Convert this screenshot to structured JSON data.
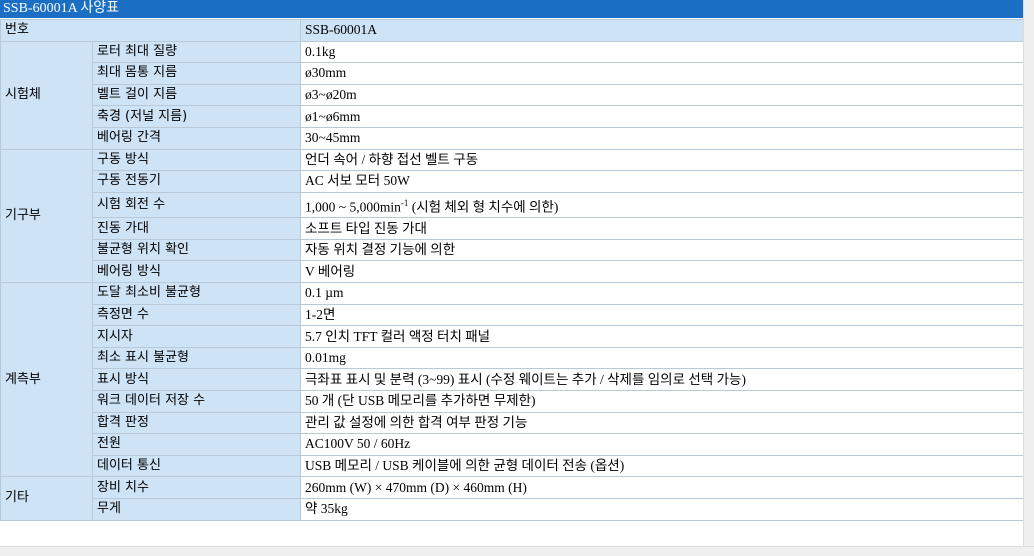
{
  "title": "SSB-60001A 사양표",
  "header": {
    "label": "번호",
    "value": "SSB-60001A"
  },
  "groups": [
    {
      "category": "시험체",
      "rows": [
        {
          "label": "로터 최대 질량",
          "value": "0.1kg"
        },
        {
          "label": "최대 몸통 지름",
          "value": "ø30mm"
        },
        {
          "label": "벨트 걸이 지름",
          "value": "ø3~ø20m"
        },
        {
          "label": "축경 (저널 지름)",
          "value": "ø1~ø6mm"
        },
        {
          "label": "베어링 간격",
          "value": "30~45mm"
        }
      ]
    },
    {
      "category": "기구부",
      "rows": [
        {
          "label": "구동 방식",
          "value": "언더 속어 / 하향 접선 벨트 구동"
        },
        {
          "label": "구동 전동기",
          "value": "AC 서보 모터 50W"
        },
        {
          "label": "시험 회전 수",
          "value": "1,000 ~ 5,000min",
          "sup": "-1",
          "value_suffix": " (시험 체외 형 치수에 의한)"
        },
        {
          "label": "진동 가대",
          "value": "소프트 타입 진동 가대"
        },
        {
          "label": "불균형 위치 확인",
          "value": "자동 위치 결정 기능에 의한"
        },
        {
          "label": "베어링 방식",
          "value": "V 베어링"
        }
      ]
    },
    {
      "category": "계측부",
      "rows": [
        {
          "label": "도달 최소비 불균형",
          "value": "0.1 µm"
        },
        {
          "label": "측정면 수",
          "value": "1-2면"
        },
        {
          "label": "지시자",
          "value": "5.7 인치 TFT 컬러 액정 터치 패널"
        },
        {
          "label": "최소 표시 불균형",
          "value": "0.01mg"
        },
        {
          "label": "표시 방식",
          "value": "극좌표 표시 및 분력 (3~99) 표시 (수정 웨이트는 추가 / 삭제를 임의로 선택 가능)"
        },
        {
          "label": "워크 데이터 저장 수",
          "value": "50 개 (단 USB 메모리를 추가하면 무제한)"
        },
        {
          "label": "합격 판정",
          "value": "관리 값 설정에 의한 합격 여부 판정 기능"
        },
        {
          "label": "전원",
          "value": "AC100V 50 / 60Hz"
        },
        {
          "label": "데이터 통신",
          "value": "USB 메모리 / USB 케이블에 의한 균형 데이터 전송 (옵션)"
        }
      ]
    },
    {
      "category": "기타",
      "rows": [
        {
          "label": "장비 치수",
          "value": "260mm (W) × 470mm (D) × 460mm (H)"
        },
        {
          "label": "무게",
          "value": "약 35kg"
        }
      ]
    }
  ]
}
